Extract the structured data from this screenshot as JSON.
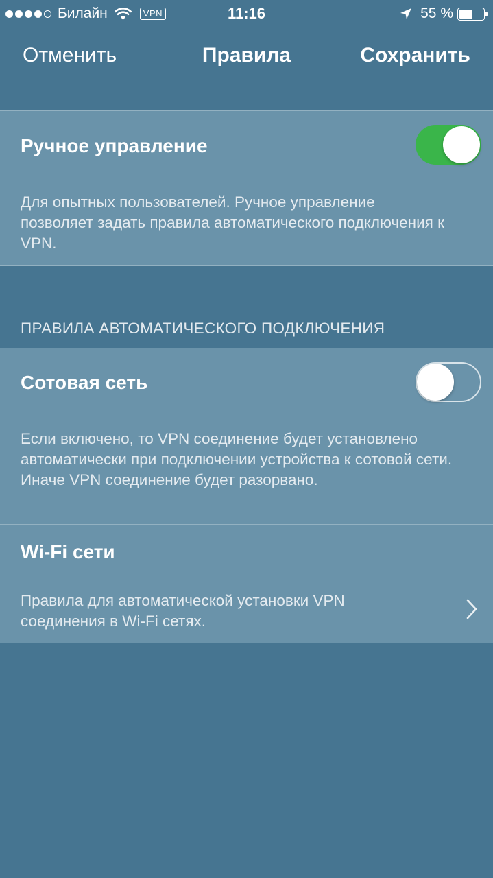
{
  "status_bar": {
    "carrier": "Билайн",
    "vpn_badge": "VPN",
    "time": "11:16",
    "battery": "55 %",
    "signal_strength": 4,
    "signal_max": 5,
    "battery_level": 0.55
  },
  "nav": {
    "cancel": "Отменить",
    "title": "Правила",
    "save": "Сохранить"
  },
  "manual": {
    "title": "Ручное управление",
    "description": "Для опытных пользователей. Ручное управление позволяет задать правила автоматического подключения к VPN.",
    "enabled": true
  },
  "auto_section": {
    "header": "ПРАВИЛА АВТОМАТИЧЕСКОГО ПОДКЛЮЧЕНИЯ",
    "cellular": {
      "title": "Сотовая сеть",
      "description": "Если включено, то VPN соединение будет установлено автоматически при подключении устройства к сотовой сети. Иначе VPN соединение будет разорвано.",
      "enabled": false
    },
    "wifi": {
      "title": "Wi-Fi сети",
      "description": "Правила для автоматической установки VPN соединения в Wi-Fi сетях."
    }
  },
  "colors": {
    "background": "#467591",
    "cell": "#6a93aa",
    "toggle_on": "#3ab54a"
  }
}
